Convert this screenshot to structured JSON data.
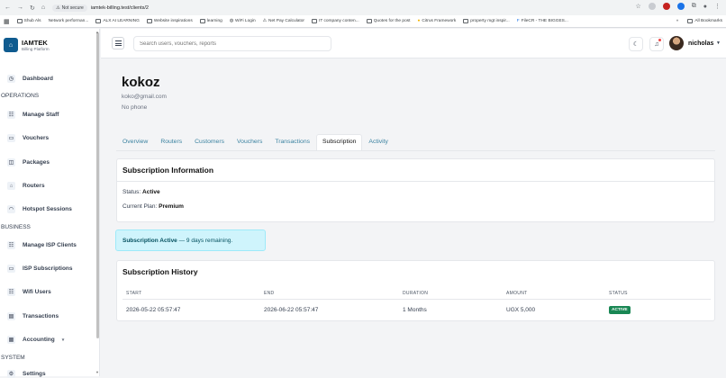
{
  "browser": {
    "not_secure": "Not secure",
    "url": "iamtek-billing.test/clients/2",
    "bookmarks": [
      "Shub Als",
      "Network performan...",
      "ALX AI LEARNING",
      "Website inspirations",
      "learning",
      "WiFi Login",
      "Net Pay Calculator",
      "IT company conten...",
      "Quotes for the post",
      "Citrus Framework",
      "property mgt inspir...",
      "FileCR - THE BIGGES..."
    ],
    "all_bookmarks": "All Bookmarks",
    "more": "»"
  },
  "brand": {
    "name": "IAMTEK",
    "subtitle": "Billing Platform"
  },
  "sidebar": {
    "dashboard": "Dashboard",
    "operations": "OPERATIONS",
    "manage_staff": "Manage Staff",
    "vouchers": "Vouchers",
    "packages": "Packages",
    "routers": "Routers",
    "hotspot_sessions": "Hotspot Sessions",
    "business": "BUSINESS",
    "manage_isp_clients": "Manage ISP Clients",
    "isp_subscriptions": "ISP Subscriptions",
    "wifi_users": "Wifi Users",
    "transactions": "Transactions",
    "accounting": "Accounting",
    "system": "SYSTEM",
    "settings": "Settings"
  },
  "topbar": {
    "search_placeholder": "Search users, vouchers, reports",
    "username": "nicholas"
  },
  "client": {
    "name": "kokoz",
    "email": "koko@gmail.com",
    "phone": "No phone"
  },
  "tabs": [
    "Overview",
    "Routers",
    "Customers",
    "Vouchers",
    "Transactions",
    "Subscription",
    "Activity"
  ],
  "subscription_info": {
    "title": "Subscription Information",
    "status_label": "Status:",
    "status_value": "Active",
    "plan_label": "Current Plan:",
    "plan_value": "Premium"
  },
  "alert": {
    "strong": "Subscription Active",
    "rest": " — 9 days remaining."
  },
  "history": {
    "title": "Subscription History",
    "columns": [
      "START",
      "END",
      "DURATION",
      "AMOUNT",
      "STATUS"
    ],
    "rows": [
      {
        "start": "2026-05-22 05:57:47",
        "end": "2026-06-22 05:57:47",
        "duration": "1 Months",
        "amount": "UGX 5,000",
        "status": "ACTIVE"
      }
    ]
  },
  "colors": {
    "brand": "#0f5b8f",
    "alert_bg": "#cff4fc",
    "active_badge": "#198754",
    "tab_link": "#3b82a0"
  }
}
